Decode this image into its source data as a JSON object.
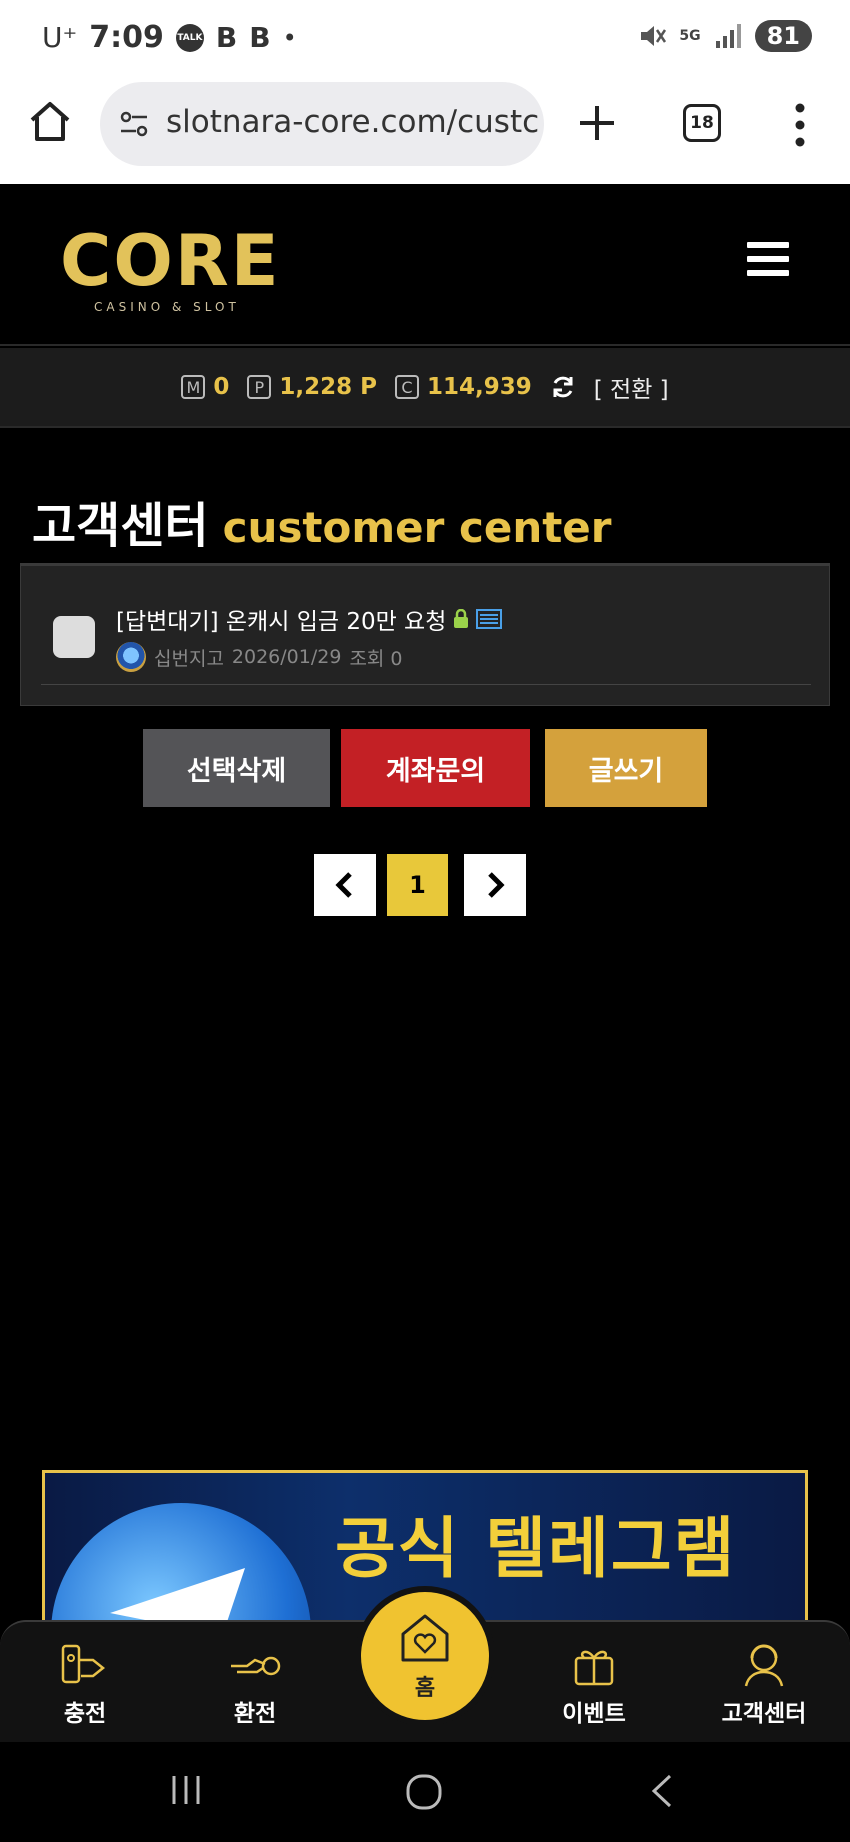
{
  "status_bar": {
    "carrier": "U⁺",
    "time": "7:09",
    "talk_badge": "TALK",
    "b1": "B",
    "b2": "B",
    "dot": "•",
    "network": "5G",
    "battery": "81"
  },
  "browser": {
    "url": "slotnara-core.com/custc",
    "tab_count": "18"
  },
  "header": {
    "logo_text": "CORE",
    "logo_sub": "CASINO & SLOT"
  },
  "points": {
    "m_icon": "M",
    "m_value": "0",
    "p_icon": "P",
    "p_value": "1,228 P",
    "c_icon": "C",
    "c_value": "114,939",
    "convert_label": "[ 전환 ]"
  },
  "page": {
    "title_ko": "고객센터",
    "title_en": "customer center"
  },
  "posts": [
    {
      "title": "[답변대기] 온캐시 입금 20만 요청",
      "author": "십번지고",
      "date": "2026/01/29",
      "views_label": "조회 0"
    }
  ],
  "actions": {
    "delete_selected": "선택삭제",
    "account_inquiry": "계좌문의",
    "write": "글쓰기"
  },
  "pagination": {
    "current": "1"
  },
  "banner": {
    "text": "공식 텔레그램"
  },
  "bottom_nav": {
    "charge": "충전",
    "exchange": "환전",
    "home": "홈",
    "event": "이벤트",
    "support": "고객센터"
  },
  "colors": {
    "accent_gold": "#e8c24a",
    "delete_btn": "#545457",
    "account_btn": "#c32025",
    "write_btn": "#d4a13c",
    "page_current": "#e8c83a",
    "home_btn": "#f0c330"
  }
}
